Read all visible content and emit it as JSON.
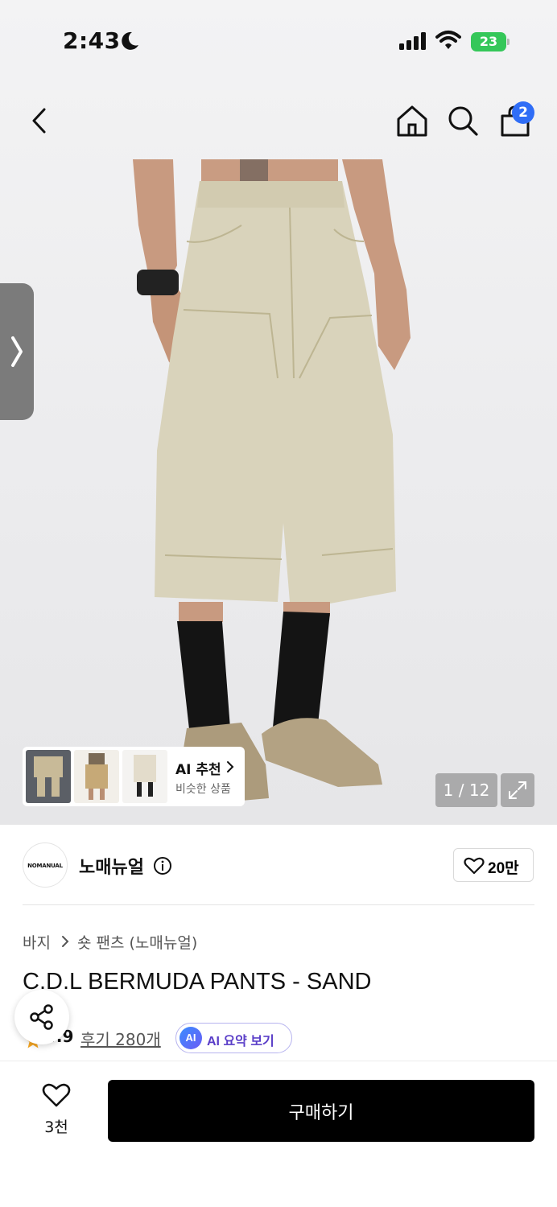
{
  "status_bar": {
    "time": "2:43",
    "battery": "23"
  },
  "header": {
    "cart_badge": "2"
  },
  "gallery": {
    "reco_title": "AI 추천",
    "reco_subtitle": "비슷한 상품",
    "counter": "1 / 12"
  },
  "brand": {
    "logo_text": "NOMANUAL",
    "name": "노매뉴얼",
    "likes": "20만"
  },
  "breadcrumb": {
    "category": "바지",
    "subcategory": "숏 팬츠 (노매뉴얼)"
  },
  "product": {
    "title": "C.D.L BERMUDA PANTS - SAND",
    "rating": "4.9",
    "reviews": "후기 280개",
    "ai_badge": "AI",
    "ai_summary": "AI 요약 보기"
  },
  "footer": {
    "wish_count": "3천",
    "buy_label": "구매하기"
  },
  "colors": {
    "accent_blue": "#2f6df6",
    "battery_green": "#35c759",
    "ai_purple": "#5a3ec8",
    "buy_button": "#000000"
  },
  "icons": [
    "moon-icon",
    "signal-icon",
    "wifi-icon",
    "back-icon",
    "home-icon",
    "search-icon",
    "cart-icon",
    "chevron-right-icon",
    "expand-icon",
    "info-icon",
    "heart-icon",
    "share-icon",
    "star-icon"
  ]
}
